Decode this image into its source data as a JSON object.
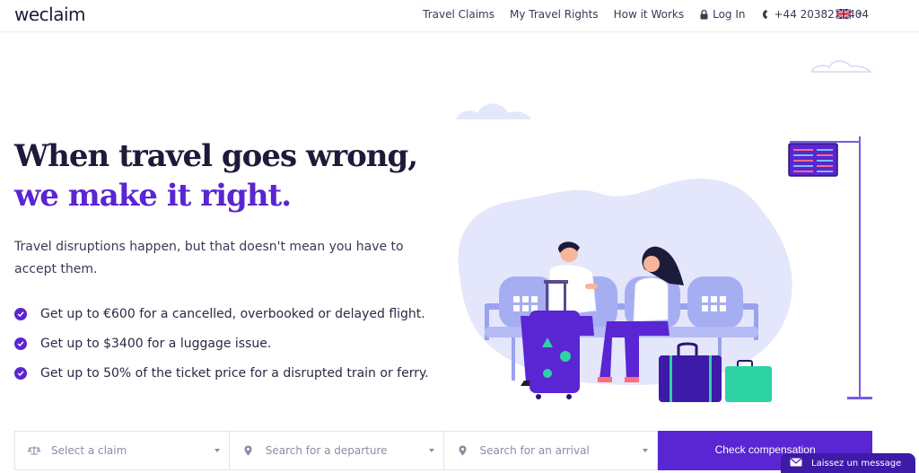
{
  "header": {
    "logo": "weclaim",
    "nav": {
      "travel_claims": "Travel Claims",
      "travel_rights": "My Travel Rights",
      "how_it_works": "How it Works",
      "log_in": "Log In",
      "phone": "+44 2038236404"
    },
    "language_flag": "uk-flag-icon"
  },
  "hero": {
    "title_line1": "When travel goes wrong,",
    "title_line2": "we make it right.",
    "subtitle": "Travel disruptions happen, but that doesn't mean you have to accept them.",
    "bullets": [
      "Get up to €600 for a cancelled, overbooked or delayed flight.",
      "Get up to $3400 for a luggage issue.",
      "Get up to 50% of the ticket price for a disrupted train or ferry."
    ]
  },
  "search": {
    "claim_placeholder": "Select a claim",
    "departure_placeholder": "Search for a departure",
    "arrival_placeholder": "Search for an arrival",
    "button": "Check compensation"
  },
  "chat": {
    "label": "Laissez un message"
  },
  "colors": {
    "brand_purple": "#5a25d2",
    "dark_text": "#1d1b3a",
    "illustration_light": "#e4e6fb",
    "teal": "#2ed3a4",
    "navy": "#27186b"
  }
}
